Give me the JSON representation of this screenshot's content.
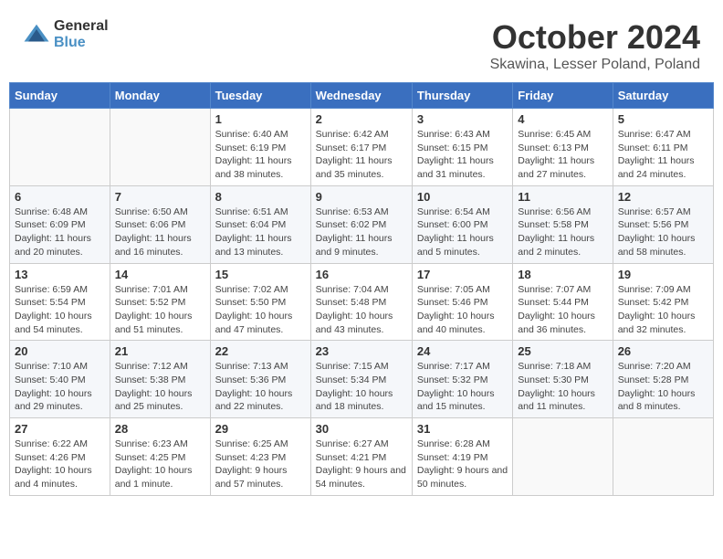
{
  "header": {
    "logo_general": "General",
    "logo_blue": "Blue",
    "month_title": "October 2024",
    "subtitle": "Skawina, Lesser Poland, Poland"
  },
  "days_of_week": [
    "Sunday",
    "Monday",
    "Tuesday",
    "Wednesday",
    "Thursday",
    "Friday",
    "Saturday"
  ],
  "weeks": [
    [
      {
        "day": "",
        "sunrise": "",
        "sunset": "",
        "daylight": ""
      },
      {
        "day": "",
        "sunrise": "",
        "sunset": "",
        "daylight": ""
      },
      {
        "day": "1",
        "sunrise": "Sunrise: 6:40 AM",
        "sunset": "Sunset: 6:19 PM",
        "daylight": "Daylight: 11 hours and 38 minutes."
      },
      {
        "day": "2",
        "sunrise": "Sunrise: 6:42 AM",
        "sunset": "Sunset: 6:17 PM",
        "daylight": "Daylight: 11 hours and 35 minutes."
      },
      {
        "day": "3",
        "sunrise": "Sunrise: 6:43 AM",
        "sunset": "Sunset: 6:15 PM",
        "daylight": "Daylight: 11 hours and 31 minutes."
      },
      {
        "day": "4",
        "sunrise": "Sunrise: 6:45 AM",
        "sunset": "Sunset: 6:13 PM",
        "daylight": "Daylight: 11 hours and 27 minutes."
      },
      {
        "day": "5",
        "sunrise": "Sunrise: 6:47 AM",
        "sunset": "Sunset: 6:11 PM",
        "daylight": "Daylight: 11 hours and 24 minutes."
      }
    ],
    [
      {
        "day": "6",
        "sunrise": "Sunrise: 6:48 AM",
        "sunset": "Sunset: 6:09 PM",
        "daylight": "Daylight: 11 hours and 20 minutes."
      },
      {
        "day": "7",
        "sunrise": "Sunrise: 6:50 AM",
        "sunset": "Sunset: 6:06 PM",
        "daylight": "Daylight: 11 hours and 16 minutes."
      },
      {
        "day": "8",
        "sunrise": "Sunrise: 6:51 AM",
        "sunset": "Sunset: 6:04 PM",
        "daylight": "Daylight: 11 hours and 13 minutes."
      },
      {
        "day": "9",
        "sunrise": "Sunrise: 6:53 AM",
        "sunset": "Sunset: 6:02 PM",
        "daylight": "Daylight: 11 hours and 9 minutes."
      },
      {
        "day": "10",
        "sunrise": "Sunrise: 6:54 AM",
        "sunset": "Sunset: 6:00 PM",
        "daylight": "Daylight: 11 hours and 5 minutes."
      },
      {
        "day": "11",
        "sunrise": "Sunrise: 6:56 AM",
        "sunset": "Sunset: 5:58 PM",
        "daylight": "Daylight: 11 hours and 2 minutes."
      },
      {
        "day": "12",
        "sunrise": "Sunrise: 6:57 AM",
        "sunset": "Sunset: 5:56 PM",
        "daylight": "Daylight: 10 hours and 58 minutes."
      }
    ],
    [
      {
        "day": "13",
        "sunrise": "Sunrise: 6:59 AM",
        "sunset": "Sunset: 5:54 PM",
        "daylight": "Daylight: 10 hours and 54 minutes."
      },
      {
        "day": "14",
        "sunrise": "Sunrise: 7:01 AM",
        "sunset": "Sunset: 5:52 PM",
        "daylight": "Daylight: 10 hours and 51 minutes."
      },
      {
        "day": "15",
        "sunrise": "Sunrise: 7:02 AM",
        "sunset": "Sunset: 5:50 PM",
        "daylight": "Daylight: 10 hours and 47 minutes."
      },
      {
        "day": "16",
        "sunrise": "Sunrise: 7:04 AM",
        "sunset": "Sunset: 5:48 PM",
        "daylight": "Daylight: 10 hours and 43 minutes."
      },
      {
        "day": "17",
        "sunrise": "Sunrise: 7:05 AM",
        "sunset": "Sunset: 5:46 PM",
        "daylight": "Daylight: 10 hours and 40 minutes."
      },
      {
        "day": "18",
        "sunrise": "Sunrise: 7:07 AM",
        "sunset": "Sunset: 5:44 PM",
        "daylight": "Daylight: 10 hours and 36 minutes."
      },
      {
        "day": "19",
        "sunrise": "Sunrise: 7:09 AM",
        "sunset": "Sunset: 5:42 PM",
        "daylight": "Daylight: 10 hours and 32 minutes."
      }
    ],
    [
      {
        "day": "20",
        "sunrise": "Sunrise: 7:10 AM",
        "sunset": "Sunset: 5:40 PM",
        "daylight": "Daylight: 10 hours and 29 minutes."
      },
      {
        "day": "21",
        "sunrise": "Sunrise: 7:12 AM",
        "sunset": "Sunset: 5:38 PM",
        "daylight": "Daylight: 10 hours and 25 minutes."
      },
      {
        "day": "22",
        "sunrise": "Sunrise: 7:13 AM",
        "sunset": "Sunset: 5:36 PM",
        "daylight": "Daylight: 10 hours and 22 minutes."
      },
      {
        "day": "23",
        "sunrise": "Sunrise: 7:15 AM",
        "sunset": "Sunset: 5:34 PM",
        "daylight": "Daylight: 10 hours and 18 minutes."
      },
      {
        "day": "24",
        "sunrise": "Sunrise: 7:17 AM",
        "sunset": "Sunset: 5:32 PM",
        "daylight": "Daylight: 10 hours and 15 minutes."
      },
      {
        "day": "25",
        "sunrise": "Sunrise: 7:18 AM",
        "sunset": "Sunset: 5:30 PM",
        "daylight": "Daylight: 10 hours and 11 minutes."
      },
      {
        "day": "26",
        "sunrise": "Sunrise: 7:20 AM",
        "sunset": "Sunset: 5:28 PM",
        "daylight": "Daylight: 10 hours and 8 minutes."
      }
    ],
    [
      {
        "day": "27",
        "sunrise": "Sunrise: 6:22 AM",
        "sunset": "Sunset: 4:26 PM",
        "daylight": "Daylight: 10 hours and 4 minutes."
      },
      {
        "day": "28",
        "sunrise": "Sunrise: 6:23 AM",
        "sunset": "Sunset: 4:25 PM",
        "daylight": "Daylight: 10 hours and 1 minute."
      },
      {
        "day": "29",
        "sunrise": "Sunrise: 6:25 AM",
        "sunset": "Sunset: 4:23 PM",
        "daylight": "Daylight: 9 hours and 57 minutes."
      },
      {
        "day": "30",
        "sunrise": "Sunrise: 6:27 AM",
        "sunset": "Sunset: 4:21 PM",
        "daylight": "Daylight: 9 hours and 54 minutes."
      },
      {
        "day": "31",
        "sunrise": "Sunrise: 6:28 AM",
        "sunset": "Sunset: 4:19 PM",
        "daylight": "Daylight: 9 hours and 50 minutes."
      },
      {
        "day": "",
        "sunrise": "",
        "sunset": "",
        "daylight": ""
      },
      {
        "day": "",
        "sunrise": "",
        "sunset": "",
        "daylight": ""
      }
    ]
  ]
}
